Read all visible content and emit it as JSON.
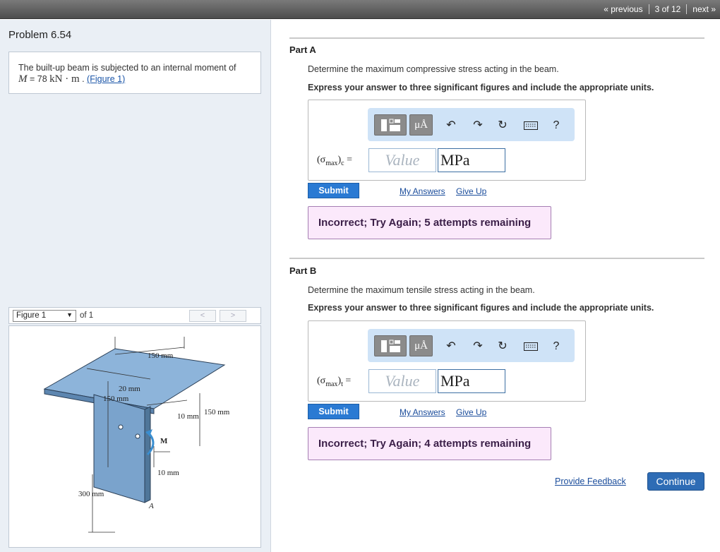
{
  "pager": {
    "previous": "« previous",
    "position": "3 of 12",
    "next": "next »"
  },
  "problem": {
    "title": "Problem 6.54",
    "statement_prefix": "The built-up beam is subjected to an internal moment of",
    "var": "M",
    "equals": " = 78 ",
    "unit": "kN · m",
    "after_unit": " . ",
    "figure_link": "(Figure 1)"
  },
  "figure": {
    "select_label": "Figure 1",
    "of_label": "of 1",
    "prev": "<",
    "next": ">",
    "dims": {
      "top_width": "150 mm",
      "thickness_top": "20 mm",
      "flange_width": "150 mm",
      "web_thickness": "10 mm",
      "web_depth": "150 mm",
      "moment": "M",
      "bottom_thickness": "10 mm",
      "height": "300 mm",
      "point": "A"
    }
  },
  "parts": [
    {
      "title": "Part A",
      "question": "Determine the maximum compressive stress acting in the beam.",
      "instruction": "Express your answer to three significant figures and include the appropriate units.",
      "label_sigma": "(σ",
      "label_sub": "max",
      "label_close": ")",
      "label_idx": "c",
      "label_eq": " =",
      "value_placeholder": "Value",
      "unit_value": "MPa",
      "submit": "Submit",
      "my_answers": "My Answers",
      "give_up": "Give Up",
      "feedback": "Incorrect; Try Again; 5 attempts remaining",
      "toolbar": {
        "units_label": "μÅ",
        "help": "?"
      }
    },
    {
      "title": "Part B",
      "question": "Determine the maximum tensile stress acting in the beam.",
      "instruction": "Express your answer to three significant figures and include the appropriate units.",
      "label_sigma": "(σ",
      "label_sub": "max",
      "label_close": ")",
      "label_idx": "t",
      "label_eq": " =",
      "value_placeholder": "Value",
      "unit_value": "MPa",
      "submit": "Submit",
      "my_answers": "My Answers",
      "give_up": "Give Up",
      "feedback": "Incorrect; Try Again; 4 attempts remaining",
      "toolbar": {
        "units_label": "μÅ",
        "help": "?"
      }
    }
  ],
  "footer": {
    "provide_feedback": "Provide Feedback",
    "continue": "Continue"
  },
  "colors": {
    "submit": "#2a7ad3",
    "feedback_bg": "#fbe9fb",
    "toolbar_bg": "#cfe3f7",
    "beam": "#7fa8cf"
  }
}
